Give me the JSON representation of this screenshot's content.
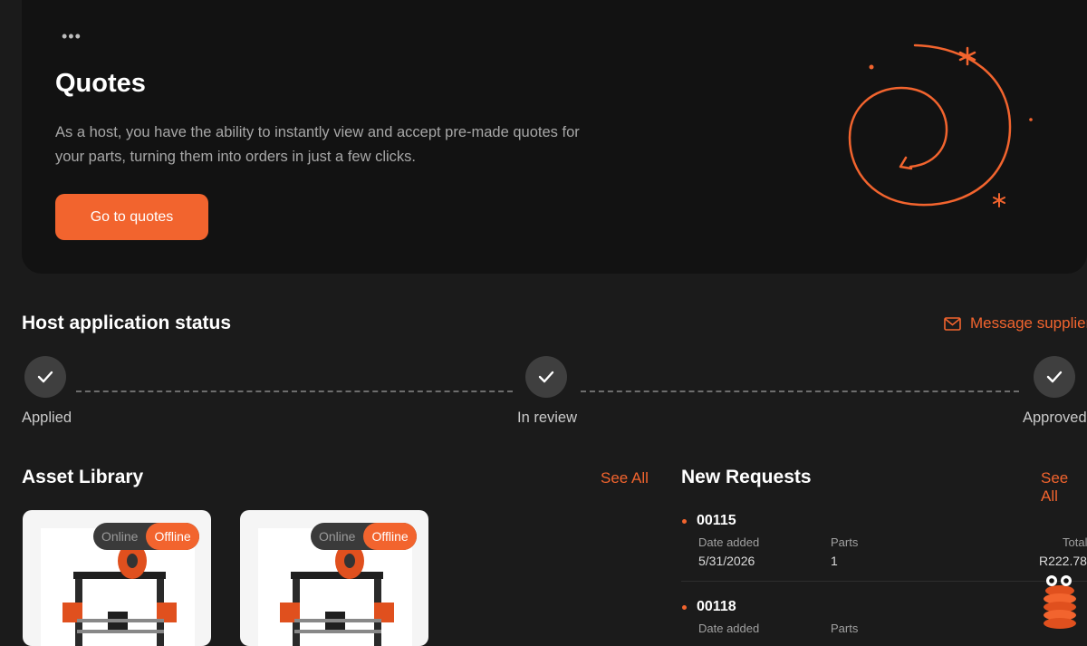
{
  "quotes": {
    "menu_icon": "ellipsis-icon",
    "title": "Quotes",
    "description": "As a host, you have the ability to instantly view and accept pre-made quotes for your parts, turning them into orders in just a few clicks.",
    "button_label": "Go to quotes"
  },
  "host_status": {
    "title": "Host application status",
    "message_link": "Message supplier",
    "steps": [
      {
        "label": "Applied",
        "done": true
      },
      {
        "label": "In review",
        "done": true
      },
      {
        "label": "Approved",
        "done": true
      }
    ]
  },
  "asset_library": {
    "title": "Asset Library",
    "see_all": "See All",
    "items": [
      {
        "online_label": "Online",
        "offline_label": "Offline",
        "status": "Offline"
      },
      {
        "online_label": "Online",
        "offline_label": "Offline",
        "status": "Offline"
      }
    ]
  },
  "new_requests": {
    "title": "New Requests",
    "see_all": "See All",
    "items": [
      {
        "id": "00115",
        "date_label": "Date added",
        "date": "5/31/2026",
        "parts_label": "Parts",
        "parts": "1",
        "total_label": "Total",
        "total": "R222.78"
      },
      {
        "id": "00118",
        "date_label": "Date added",
        "parts_label": "Parts"
      }
    ]
  },
  "colors": {
    "accent": "#f2642e",
    "background": "#1b1b1b",
    "card": "#121212"
  }
}
